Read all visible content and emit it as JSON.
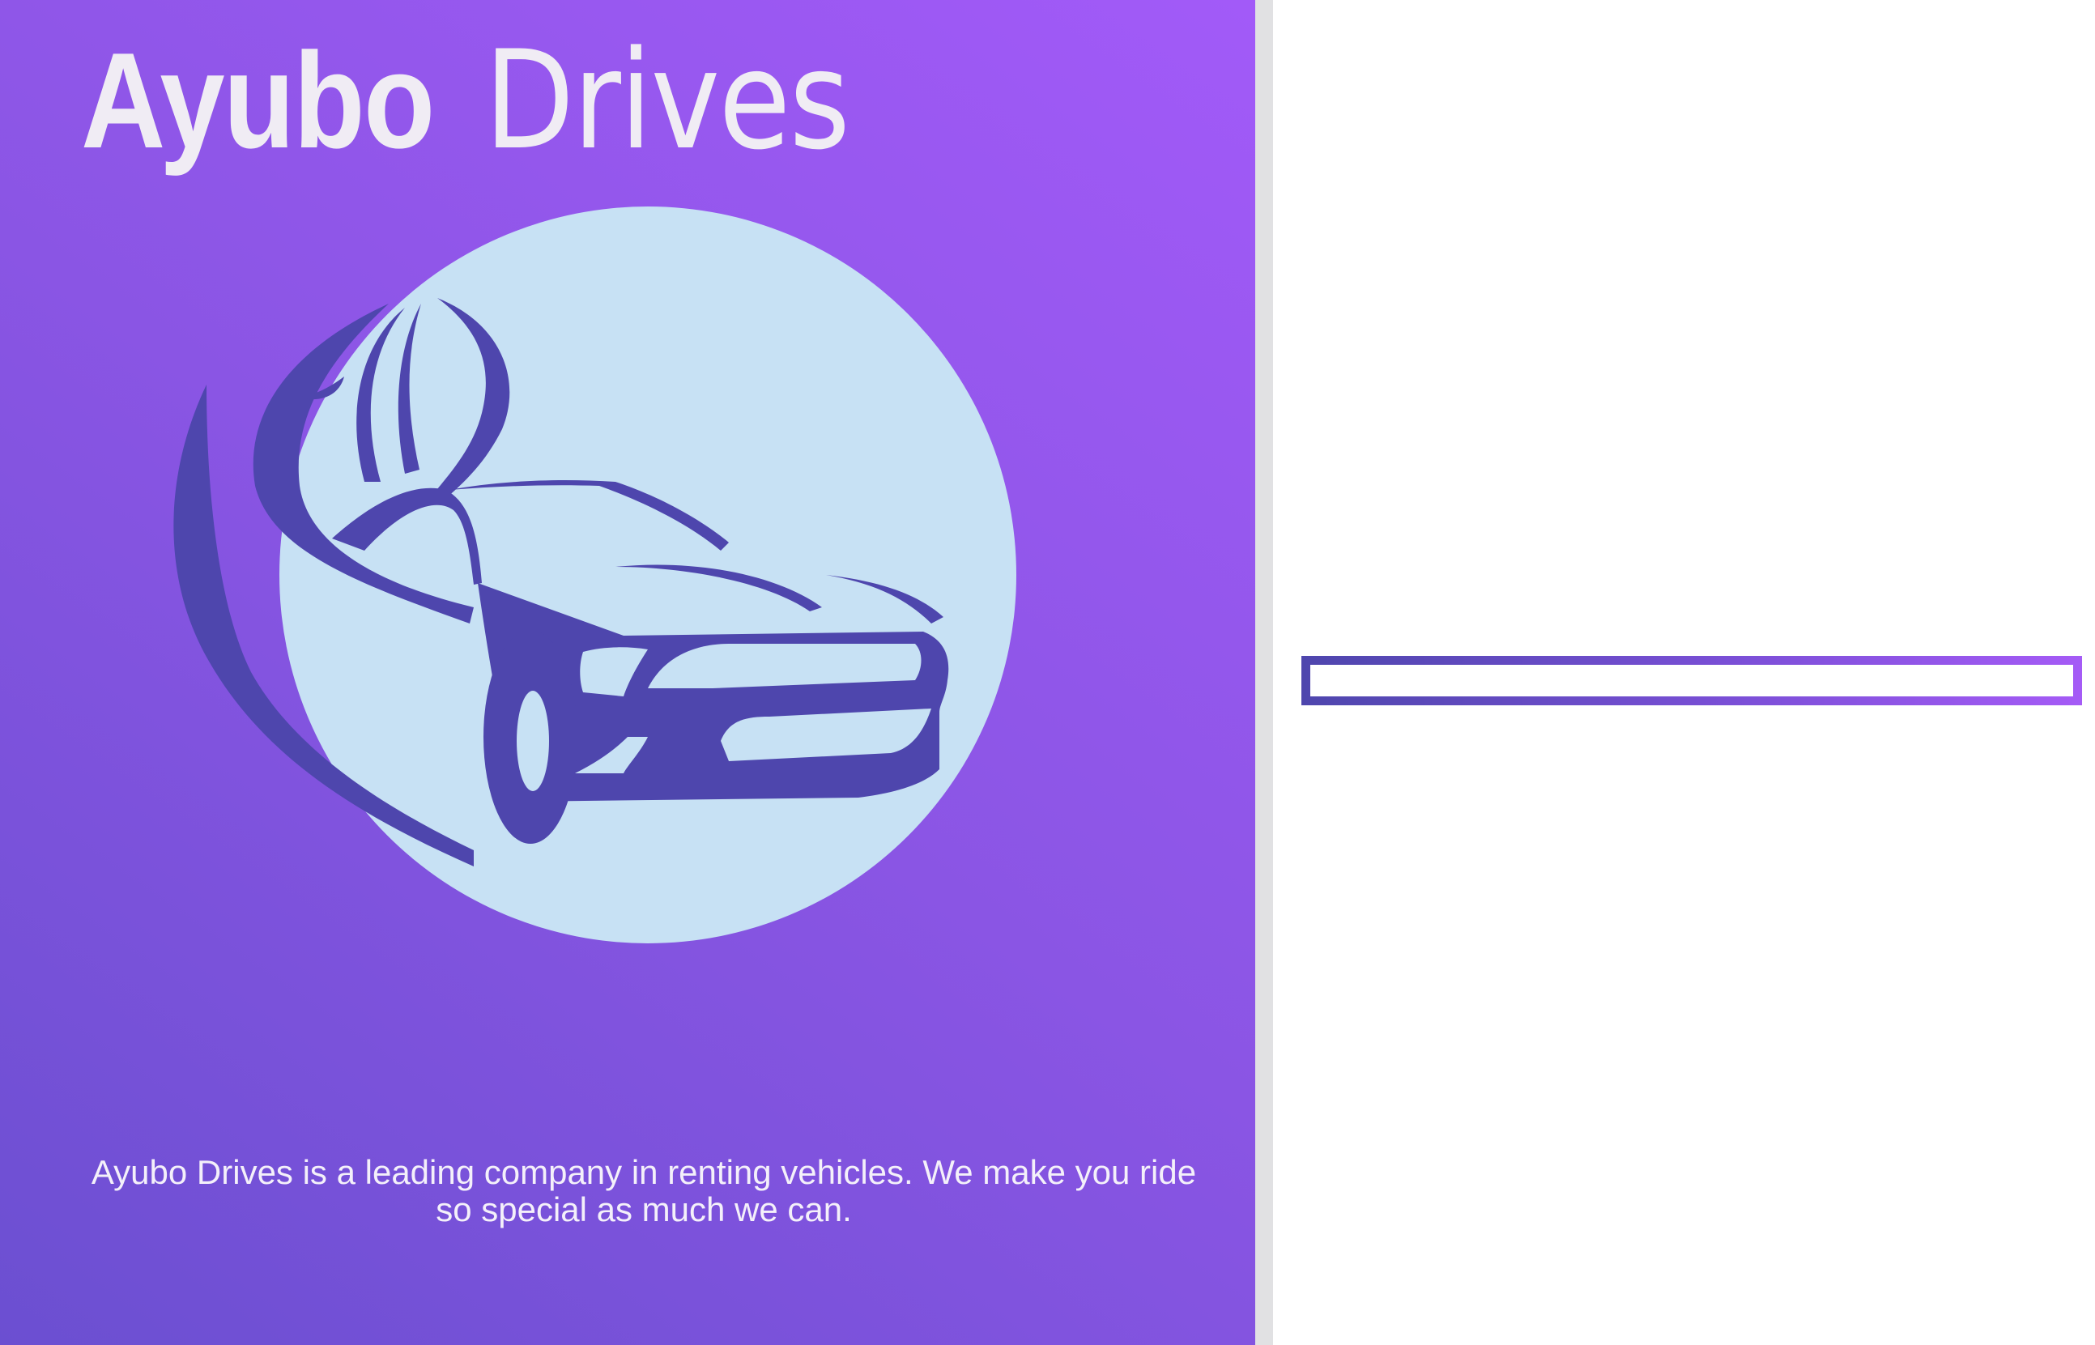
{
  "brand": {
    "name_bold": "Ayubo",
    "name_light": "Drives"
  },
  "tagline": "Ayubo Drives is a leading company in renting vehicles. We make you ride so special as much we can.",
  "logo": {
    "icon": "car-icon"
  },
  "loading": {
    "progress_percent": 0
  },
  "colors": {
    "gradient_start": "#6b4fd1",
    "gradient_end": "#a25af8",
    "logo_circle": "#c7e1f4",
    "logo_car": "#4e46ad",
    "title_text": "#f0ecf4"
  }
}
